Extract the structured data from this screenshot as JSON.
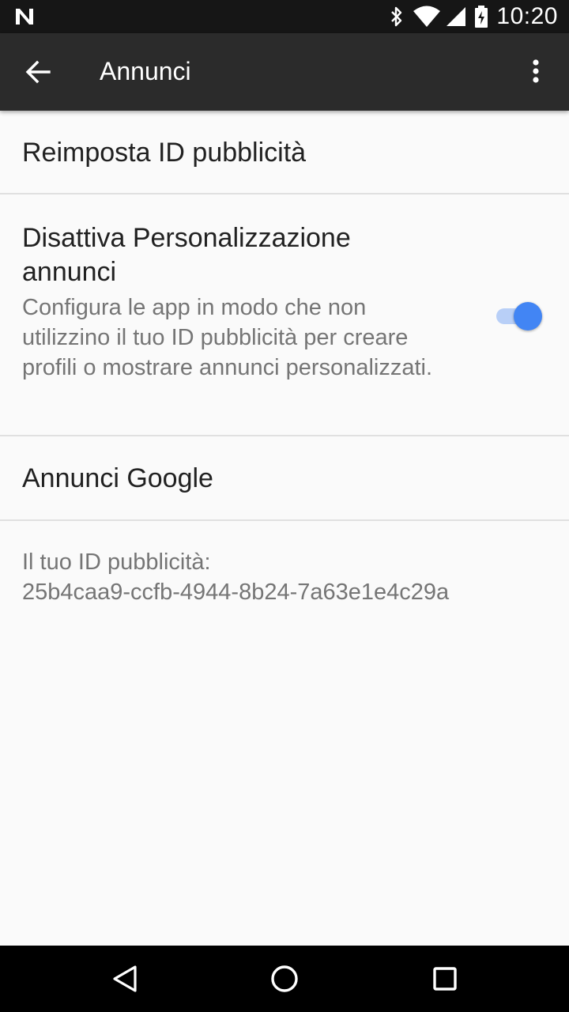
{
  "status_bar": {
    "time": "10:20",
    "icons": [
      "notification-n-icon",
      "bluetooth-icon",
      "wifi-icon",
      "cell-signal-icon",
      "battery-charging-icon"
    ]
  },
  "app_bar": {
    "title": "Annunci",
    "back_icon": "arrow-back-icon",
    "menu_icon": "more-vert-icon"
  },
  "preferences": {
    "reset": {
      "title": "Reimposta ID pubblicità"
    },
    "personalization": {
      "title": "Disattiva Personalizzazione annunci",
      "summary": "Configura le app in modo che non utilizzino il tuo ID pubblicità per creare profili o mostrare annunci personalizzati.",
      "toggle_on": true
    },
    "google_ads": {
      "title": "Annunci Google"
    }
  },
  "ad_id": {
    "label": "Il tuo ID pubblicità:",
    "value": "25b4caa9-ccfb-4944-8b24-7a63e1e4c29a"
  },
  "colors": {
    "accent": "#4285f4",
    "accent_track": "#b8cff7",
    "app_bar": "#2b2b2b",
    "status_bar": "#161616",
    "background": "#fafafa"
  },
  "nav_bar": {
    "icons": [
      "nav-back-icon",
      "nav-home-icon",
      "nav-recents-icon"
    ]
  }
}
